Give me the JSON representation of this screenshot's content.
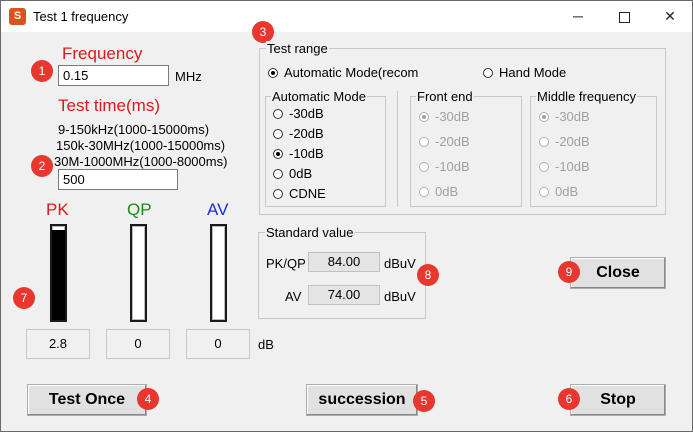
{
  "window": {
    "title": "Test 1 frequency",
    "app_icon": "app-icon",
    "minimize": "─",
    "maximize": "",
    "close": "✕"
  },
  "markers": [
    "1",
    "2",
    "3",
    "4",
    "5",
    "6",
    "7",
    "8",
    "9"
  ],
  "frequency": {
    "label": "Frequency",
    "value": "0.15",
    "unit": "MHz"
  },
  "test_time": {
    "label": "Test time(ms)",
    "hints": [
      "9-150kHz(1000-15000ms)",
      "150k-30MHz(1000-15000ms)",
      "30M-1000MHz(1000-8000ms)"
    ],
    "value": "500"
  },
  "meters": [
    {
      "label": "PK",
      "color": "#e01818",
      "level": 0.96,
      "value": "2.8"
    },
    {
      "label": "QP",
      "color": "#1a8a1a",
      "level": 0,
      "value": "0"
    },
    {
      "label": "AV",
      "color": "#1a30d0",
      "level": 0,
      "value": "0"
    }
  ],
  "db_unit": "dB",
  "test_range": {
    "label": "Test range",
    "auto_mode": "Automatic Mode(recom",
    "hand_mode": "Hand Mode",
    "selected_mode": "auto"
  },
  "automatic_mode": {
    "label": "Automatic Mode",
    "options": [
      "-30dB",
      "-20dB",
      "-10dB",
      "0dB",
      "CDNE"
    ],
    "selected": "-10dB"
  },
  "front_end": {
    "label": "Front end",
    "options": [
      "-30dB",
      "-20dB",
      "-10dB",
      "0dB"
    ],
    "selected": "-30dB"
  },
  "middle_frequency": {
    "label": "Middle frequency",
    "options": [
      "-30dB",
      "-20dB",
      "-10dB",
      "0dB"
    ],
    "selected": "-30dB"
  },
  "standard_value": {
    "label": "Standard value",
    "pkqp_label": "PK/QP",
    "pkqp_value": "84.00",
    "av_label": "AV",
    "av_value": "74.00",
    "unit": "dBuV"
  },
  "buttons": {
    "test_once": "Test Once",
    "succession": "succession",
    "stop": "Stop",
    "close": "Close"
  },
  "colors": {
    "marker": "#e8372e",
    "label_red": "#e01818"
  }
}
